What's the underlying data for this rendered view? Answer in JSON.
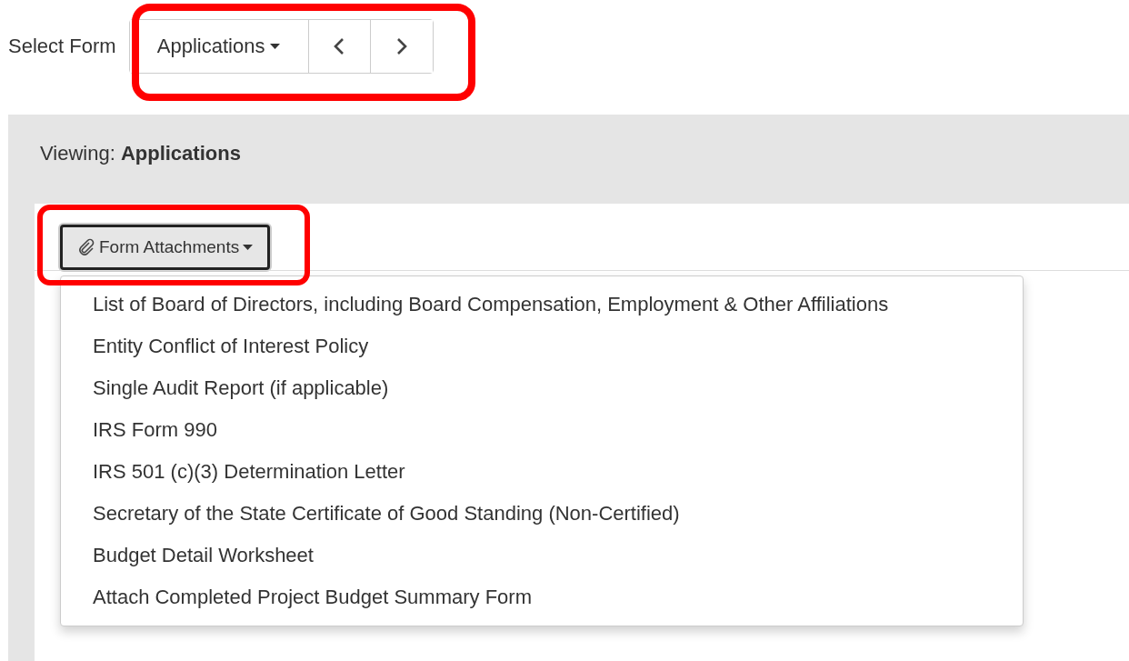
{
  "select_form": {
    "label": "Select Form",
    "dropdown": {
      "label": "Applications"
    }
  },
  "viewing": "Viewing: **Applications**",
  "attachments": {
    "label": "Form Attachments",
    "expanded": true,
    "items": [
      "List of Board of Directors, including Board Compensation, Employment & Other Affiliations",
      "Entity Conflict of Interest Policy",
      "Single Audit Report (if applicable)",
      "IRS Form 990",
      "IRS 501 (c)(3) Determination Letter",
      "Secretary of the State Certificate of Good Standing (Non-Certified)",
      "Budget Detail Worksheet",
      "Attach Completed Project Budget Summary Form"
    ]
  }
}
